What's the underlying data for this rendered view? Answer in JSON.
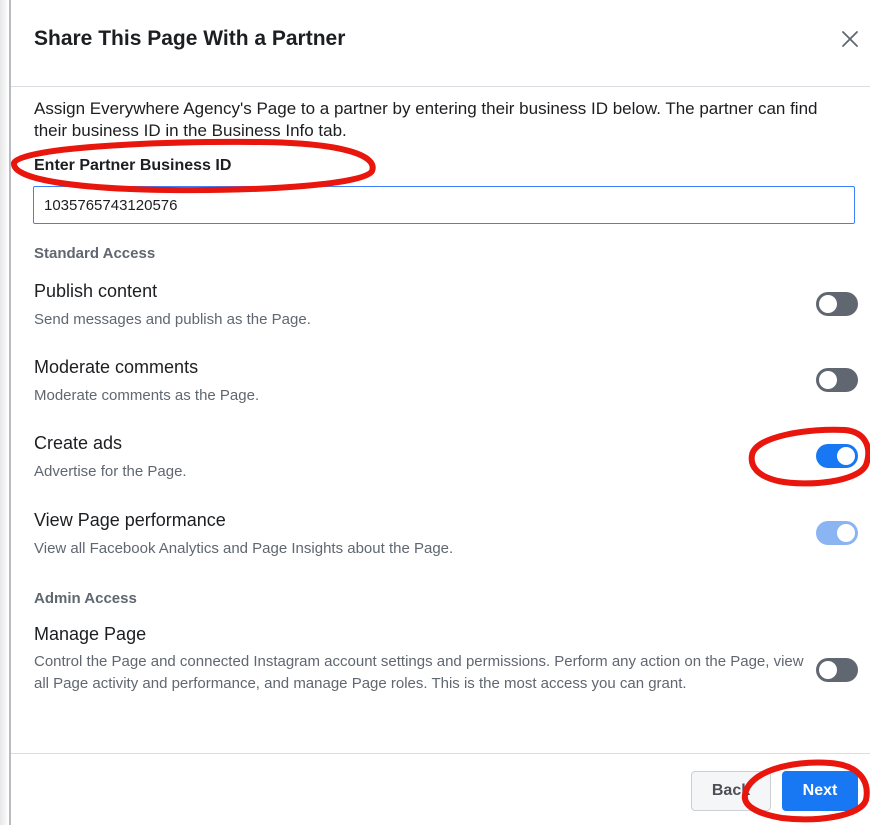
{
  "dialog": {
    "title": "Share This Page With a Partner",
    "close_icon": "close-icon",
    "intro": "Assign Everywhere Agency's Page to a partner by entering their business ID below. The partner can find their business ID in the Business Info tab.",
    "partner_id": {
      "label": "Enter Partner Business ID",
      "value": "1035765743120576"
    },
    "standard_access": {
      "heading": "Standard Access",
      "items": [
        {
          "title": "Publish content",
          "description": "Send messages and publish as the Page.",
          "enabled": false,
          "disabled": false
        },
        {
          "title": "Moderate comments",
          "description": "Moderate comments as the Page.",
          "enabled": false,
          "disabled": false
        },
        {
          "title": "Create ads",
          "description": "Advertise for the Page.",
          "enabled": true,
          "disabled": false
        },
        {
          "title": "View Page performance",
          "description": "View all Facebook Analytics and Page Insights about the Page.",
          "enabled": true,
          "disabled": true
        }
      ]
    },
    "admin_access": {
      "heading": "Admin Access",
      "items": [
        {
          "title": "Manage Page",
          "description": "Control the Page and connected Instagram account settings and permissions. Perform any action on the Page, view all Page activity and performance, and manage Page roles. This is the most access you can grant.",
          "enabled": false,
          "disabled": false
        }
      ]
    },
    "footer": {
      "back_label": "Back",
      "next_label": "Next"
    }
  },
  "colors": {
    "primary": "#1877f2",
    "toggle_off": "#606770",
    "toggle_on_disabled": "#8ab4f2",
    "annotation_red": "#e8160c",
    "secondary_text": "#606770"
  }
}
